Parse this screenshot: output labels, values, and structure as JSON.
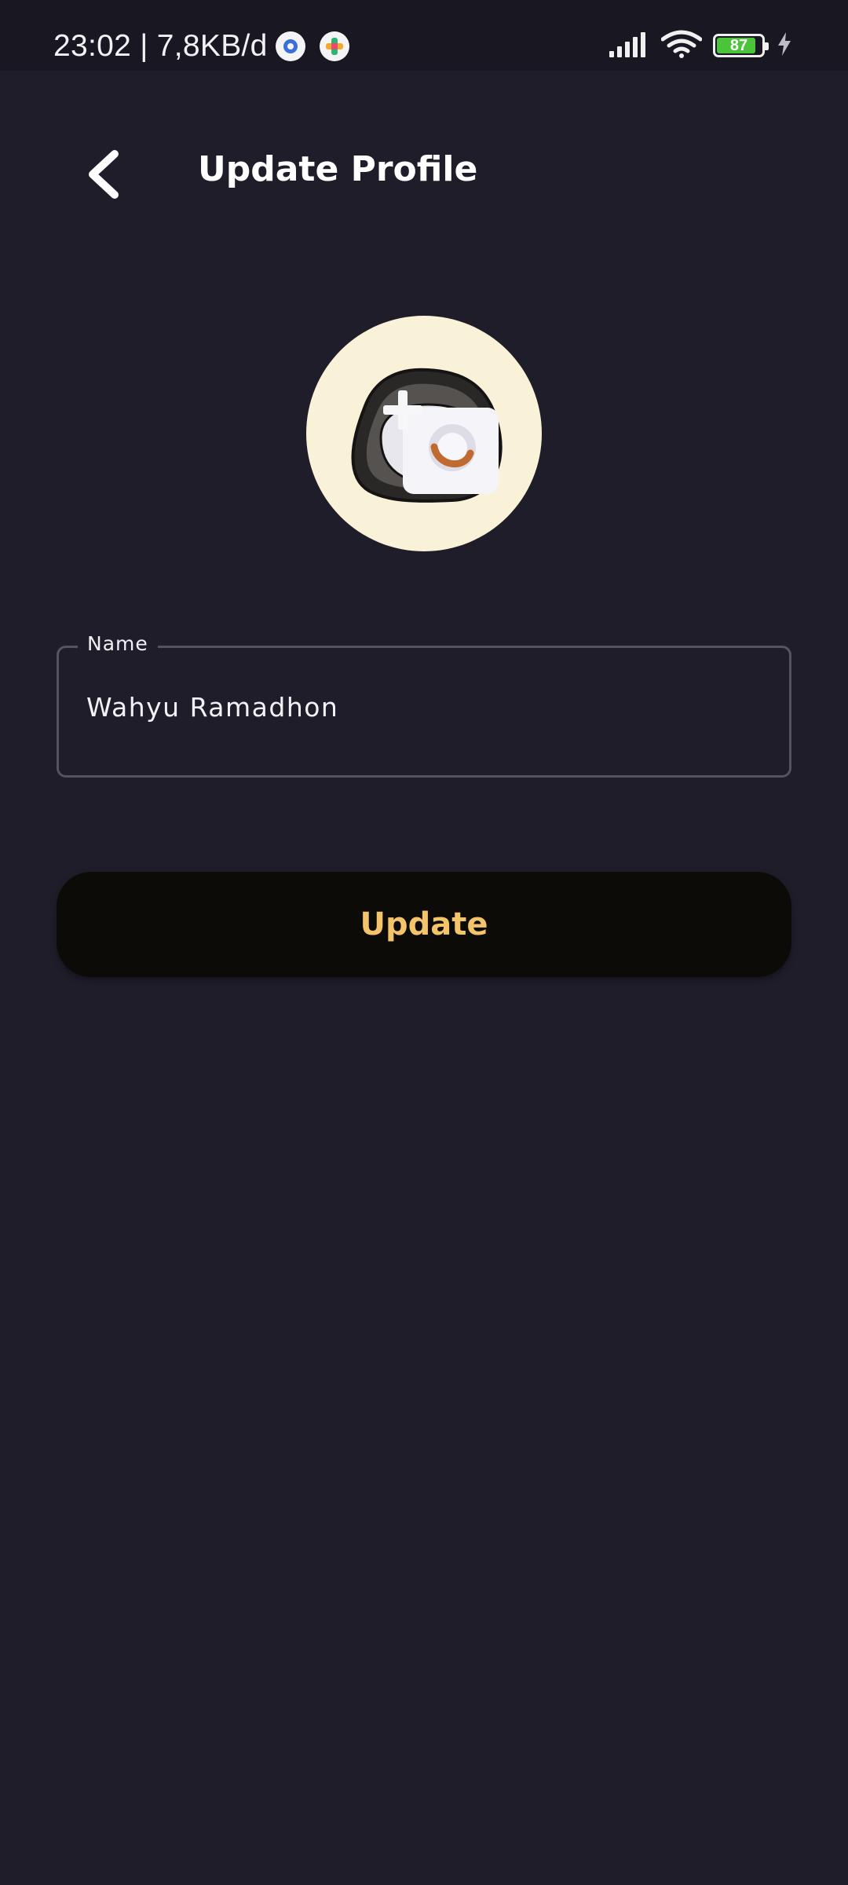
{
  "status_bar": {
    "time_network": "23:02 | 7,8KB/d",
    "battery_level": "87",
    "battery_fraction": 0.87,
    "icons": [
      "settings-app-icon",
      "game-app-icon",
      "signal-icon",
      "wifi-icon",
      "battery-icon",
      "charging-icon"
    ]
  },
  "header": {
    "title": "Update Profile",
    "back_icon": "chevron-left-icon"
  },
  "avatar": {
    "icon": "add-photo-camera-icon"
  },
  "form": {
    "name_label": "Name",
    "name_value": "Wahyu Ramadhon"
  },
  "actions": {
    "update_label": "Update"
  },
  "colors": {
    "background": "#1f1d2a",
    "status_bar": "#181722",
    "avatar_bg": "#faf1d9",
    "button_bg": "#0d0b07",
    "button_text": "#f4c46b",
    "field_border": "#55545d"
  }
}
